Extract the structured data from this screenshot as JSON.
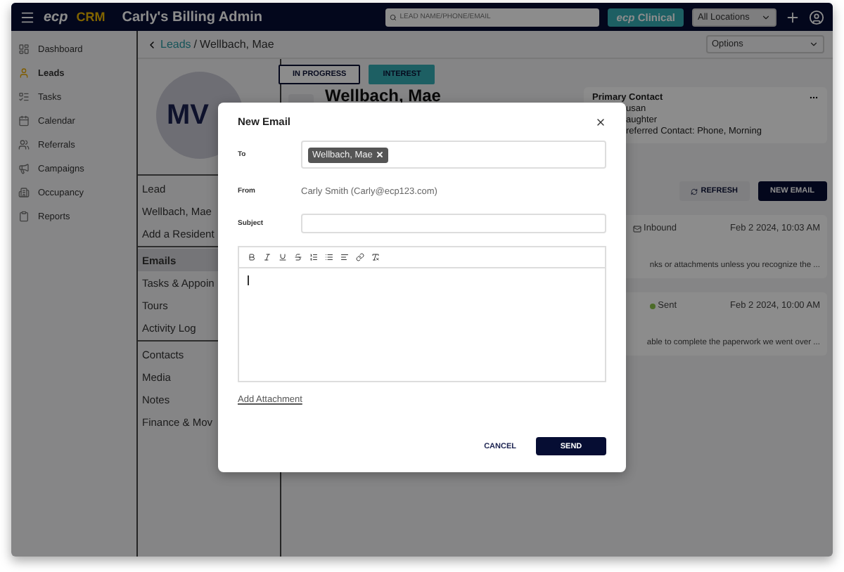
{
  "app": {
    "logo": "ecp",
    "product": "CRM",
    "title": "Carly's Billing Admin"
  },
  "search": {
    "placeholder": "LEAD NAME/PHONE/EMAIL"
  },
  "clinical_button": {
    "logo": "ecp",
    "label": "Clinical"
  },
  "location_select": "All Locations",
  "sidebar": {
    "items": [
      {
        "label": "Dashboard",
        "kind": "dashboard",
        "selected": false
      },
      {
        "label": "Leads",
        "kind": "leads",
        "selected": true
      },
      {
        "label": "Tasks",
        "kind": "tasks",
        "selected": false
      },
      {
        "label": "Calendar",
        "kind": "calendar",
        "selected": false
      },
      {
        "label": "Referrals",
        "kind": "referrals",
        "selected": false
      },
      {
        "label": "Campaigns",
        "kind": "campaigns",
        "selected": false
      },
      {
        "label": "Occupancy",
        "kind": "occupancy",
        "selected": false
      },
      {
        "label": "Reports",
        "kind": "reports",
        "selected": false
      }
    ]
  },
  "breadcrumb": {
    "link": "Leads",
    "separator": "/",
    "current": "Wellbach, Mae"
  },
  "options_select": "Options",
  "lead": {
    "initials": "MV",
    "name": "Wellbach, Mae",
    "statuses": [
      {
        "label": "IN PROGRESS",
        "kind": "outline"
      },
      {
        "label": "INTEREST",
        "kind": "filled"
      }
    ]
  },
  "lead_menu": {
    "groups": [
      {
        "items": [
          {
            "label": "Lead",
            "selected": false
          },
          {
            "label": "Wellbach, Mae",
            "selected": false
          },
          {
            "label": "Add a Resident",
            "selected": false
          }
        ]
      },
      {
        "items": [
          {
            "label": "Emails",
            "selected": true
          },
          {
            "label": "Tasks & Appoin",
            "selected": false
          },
          {
            "label": "Tours",
            "selected": false
          },
          {
            "label": "Activity Log",
            "selected": false
          }
        ]
      },
      {
        "items": [
          {
            "label": "Contacts",
            "selected": false
          },
          {
            "label": "Media",
            "selected": false
          },
          {
            "label": "Notes",
            "selected": false
          },
          {
            "label": "Finance & Mov",
            "selected": false
          }
        ]
      }
    ]
  },
  "primary_contact": {
    "title": "Primary Contact",
    "lines": [
      "usan",
      "aughter",
      "referred Contact: Phone, Morning"
    ]
  },
  "email_actions": {
    "refresh": "REFRESH",
    "new_email": "NEW EMAIL"
  },
  "emails": [
    {
      "kind": "inbound",
      "direction": "Inbound",
      "date": "Feb 2 2024, 10:03 AM",
      "snippet": "nks or attachments unless you recognize the ..."
    },
    {
      "kind": "sent",
      "direction": "Sent",
      "date": "Feb 2 2024, 10:00 AM",
      "snippet": "able to complete the paperwork we went over ..."
    }
  ],
  "modal": {
    "title": "New Email",
    "to_label": "To",
    "recipients": [
      "Wellbach, Mae"
    ],
    "from_label": "From",
    "from": "Carly Smith (Carly@ecp123.com)",
    "subject_label": "Subject",
    "add_attachment": "Add Attachment",
    "cancel": "CANCEL",
    "send": "SEND"
  }
}
